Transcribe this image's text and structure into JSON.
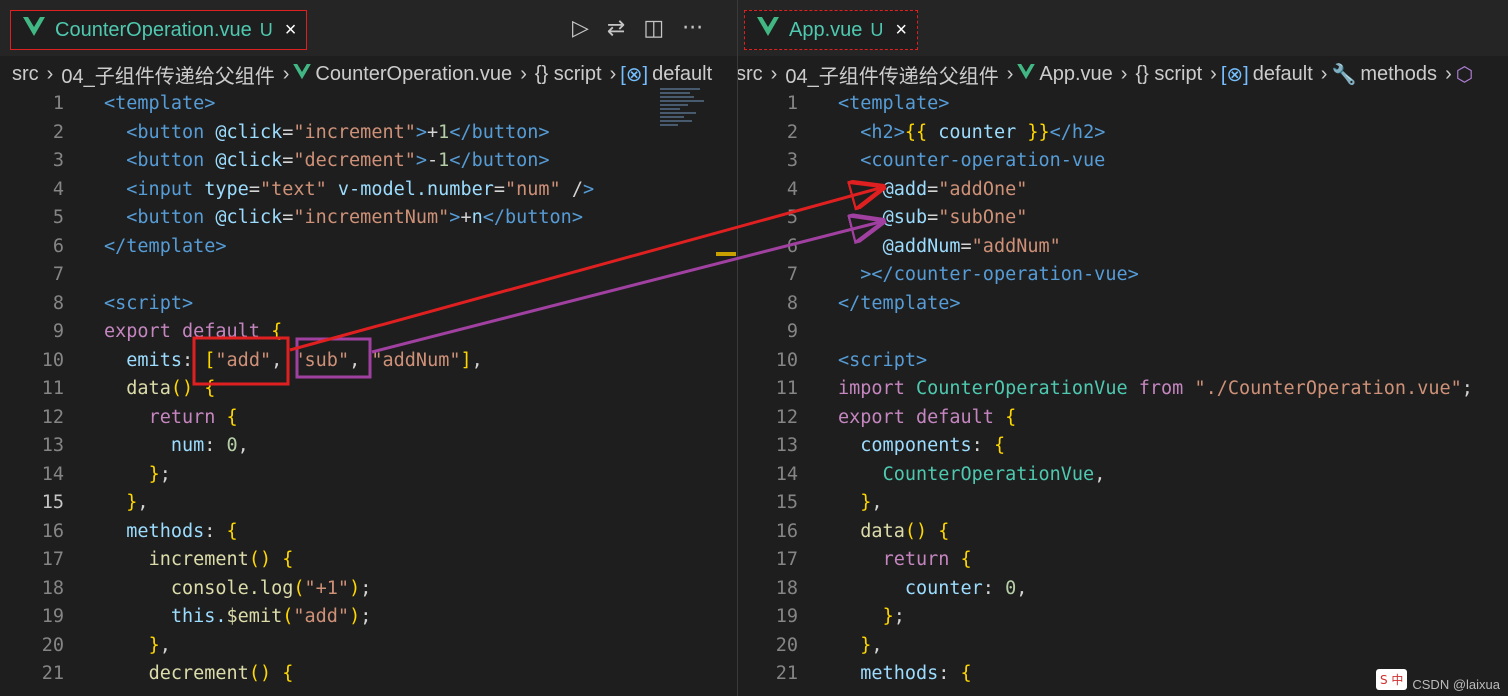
{
  "colors": {
    "background": "#1e1e1e",
    "highlight_red": "#e02020",
    "highlight_purple": "#a040a0",
    "vue_green": "#4ec9b0"
  },
  "left": {
    "tab": {
      "icon": "vue-logo-icon",
      "title": "CounterOperation.vue",
      "modified": "U",
      "close": "×"
    },
    "toolbar": {
      "run": "▷",
      "diff": "⇄",
      "split": "◫",
      "more": "···"
    },
    "breadcrumb": {
      "src": "src",
      "folder": "04_子组件传递给父组件",
      "file": "CounterOperation.vue",
      "script": "{} script",
      "default": "default"
    },
    "lines": [
      {
        "n": "1",
        "code": "<template>"
      },
      {
        "n": "2",
        "code": "  <button @click=\"increment\">+1</button>"
      },
      {
        "n": "3",
        "code": "  <button @click=\"decrement\">-1</button>"
      },
      {
        "n": "4",
        "code": "  <input type=\"text\" v-model.number=\"num\" />"
      },
      {
        "n": "5",
        "code": "  <button @click=\"incrementNum\">+n</button>"
      },
      {
        "n": "6",
        "code": "</template>"
      },
      {
        "n": "7",
        "code": ""
      },
      {
        "n": "8",
        "code": "<script>"
      },
      {
        "n": "9",
        "code": "export default {"
      },
      {
        "n": "10",
        "code": "  emits: [\"add\", \"sub\", \"addNum\"],"
      },
      {
        "n": "11",
        "code": "  data() {"
      },
      {
        "n": "12",
        "code": "    return {"
      },
      {
        "n": "13",
        "code": "      num: 0,"
      },
      {
        "n": "14",
        "code": "    };"
      },
      {
        "n": "15",
        "code": "  },"
      },
      {
        "n": "16",
        "code": "  methods: {"
      },
      {
        "n": "17",
        "code": "    increment() {"
      },
      {
        "n": "18",
        "code": "      console.log(\"+1\");"
      },
      {
        "n": "19",
        "code": "      this.$emit(\"add\");"
      },
      {
        "n": "20",
        "code": "    },"
      },
      {
        "n": "21",
        "code": "    decrement() {"
      }
    ],
    "active_line": "15"
  },
  "right": {
    "tab": {
      "icon": "vue-logo-icon",
      "title": "App.vue",
      "modified": "U",
      "close": "×"
    },
    "breadcrumb": {
      "src": "src",
      "folder": "04_子组件传递给父组件",
      "file": "App.vue",
      "script": "{} script",
      "default": "default",
      "methods": "methods"
    },
    "lines": [
      {
        "n": "1",
        "code": "<template>"
      },
      {
        "n": "2",
        "code": "  <h2>{{ counter }}</h2>"
      },
      {
        "n": "3",
        "code": "  <counter-operation-vue"
      },
      {
        "n": "4",
        "code": "    @add=\"addOne\""
      },
      {
        "n": "5",
        "code": "    @sub=\"subOne\""
      },
      {
        "n": "6",
        "code": "    @addNum=\"addNum\""
      },
      {
        "n": "7",
        "code": "  ></counter-operation-vue>"
      },
      {
        "n": "8",
        "code": "</template>"
      },
      {
        "n": "9",
        "code": ""
      },
      {
        "n": "10",
        "code": "<script>"
      },
      {
        "n": "11",
        "code": "import CounterOperationVue from \"./CounterOperation.vue\";"
      },
      {
        "n": "12",
        "code": "export default {"
      },
      {
        "n": "13",
        "code": "  components: {"
      },
      {
        "n": "14",
        "code": "    CounterOperationVue,"
      },
      {
        "n": "15",
        "code": "  },"
      },
      {
        "n": "16",
        "code": "  data() {"
      },
      {
        "n": "17",
        "code": "    return {"
      },
      {
        "n": "18",
        "code": "      counter: 0,"
      },
      {
        "n": "19",
        "code": "    };"
      },
      {
        "n": "20",
        "code": "  },"
      },
      {
        "n": "21",
        "code": "  methods: {"
      }
    ]
  },
  "watermark": "CSDN @laixua"
}
